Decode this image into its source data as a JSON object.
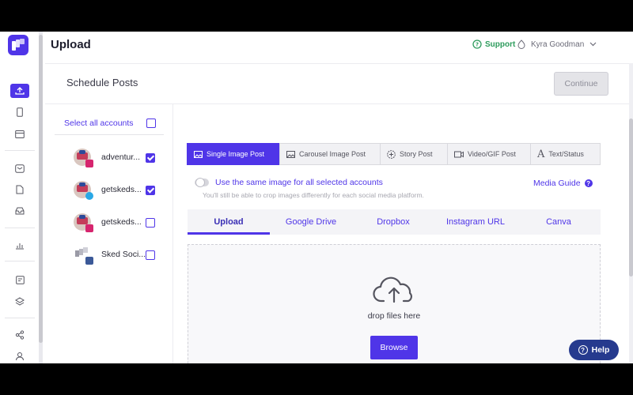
{
  "header": {
    "title": "Upload",
    "support_label": "Support",
    "user_name": "Kyra Goodman"
  },
  "schedule": {
    "title": "Schedule Posts",
    "continue_label": "Continue",
    "continue_disabled": true
  },
  "accounts": {
    "select_all_label": "Select all accounts",
    "select_all_checked": false,
    "items": [
      {
        "name": "adventur...",
        "network": "instagram",
        "checked": true
      },
      {
        "name": "getskeds...",
        "network": "twitter",
        "checked": true
      },
      {
        "name": "getskeds...",
        "network": "instagram",
        "checked": false
      },
      {
        "name": "Sked Soci...",
        "network": "facebook",
        "checked": false
      }
    ]
  },
  "post_types": [
    {
      "label": "Single Image Post",
      "icon": "image-icon",
      "active": true
    },
    {
      "label": "Carousel Image Post",
      "icon": "image-icon",
      "active": false
    },
    {
      "label": "Story Post",
      "icon": "story-icon",
      "active": false
    },
    {
      "label": "Video/GIF Post",
      "icon": "video-icon",
      "active": false
    },
    {
      "label": "Text/Status",
      "icon": "text-icon",
      "active": false
    }
  ],
  "options": {
    "same_image_label": "Use the same image for all selected accounts",
    "same_image_enabled": false,
    "crop_note": "You'll still be able to crop images differently for each social media platform.",
    "media_guide_label": "Media Guide"
  },
  "upload_sources": [
    {
      "label": "Upload",
      "active": true
    },
    {
      "label": "Google Drive",
      "active": false
    },
    {
      "label": "Dropbox",
      "active": false
    },
    {
      "label": "Instagram URL",
      "active": false
    },
    {
      "label": "Canva",
      "active": false
    }
  ],
  "dropzone": {
    "label": "drop files here",
    "browse_label": "Browse"
  },
  "help_label": "Help",
  "colors": {
    "accent": "#4f35e8",
    "support_green": "#2d9b5c",
    "help_navy": "#263a8e"
  }
}
